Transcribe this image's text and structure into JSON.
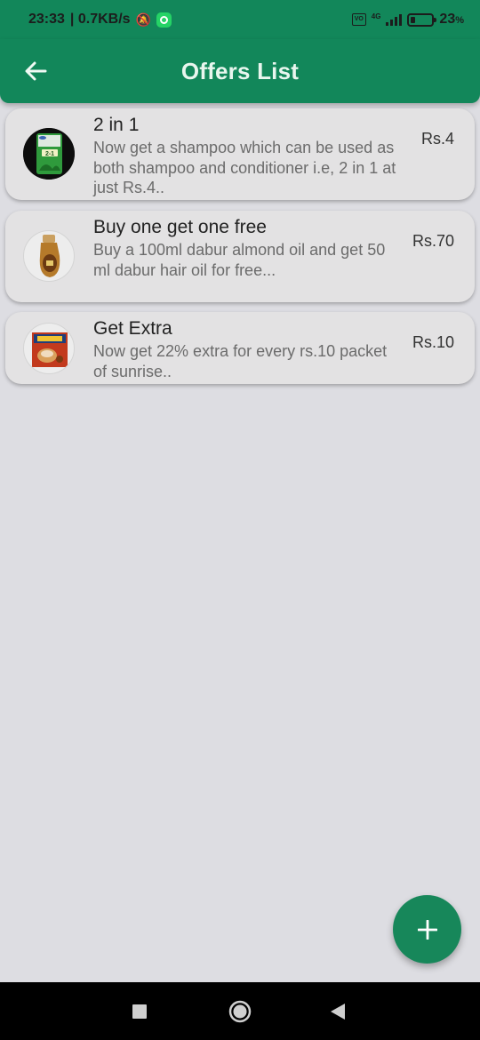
{
  "status_bar": {
    "time": "23:33",
    "network_speed": "| 0.7KB/s",
    "network_type": "4G",
    "battery_level": "23",
    "battery_unit": "%"
  },
  "header": {
    "title": "Offers List"
  },
  "offers": [
    {
      "title": "2 in 1",
      "description": "Now get a shampoo which can be used as both shampoo and conditioner i.e, 2 in 1 at just Rs.4..",
      "price": "Rs.4"
    },
    {
      "title": "Buy one get one free",
      "description": "Buy a 100ml dabur almond oil and get 50 ml dabur hair oil for free...",
      "price": "Rs.70"
    },
    {
      "title": "Get Extra",
      "description": "Now get 22% extra for every rs.10 packet of sunrise..",
      "price": "Rs.10"
    }
  ],
  "icons": {
    "back": "arrow-left-icon",
    "add": "plus-icon",
    "nav_recent": "square-icon",
    "nav_home": "circle-icon",
    "nav_back": "triangle-left-icon"
  },
  "colors": {
    "primary": "#12875a",
    "background": "#dddde2",
    "card": "#e3e2e3"
  }
}
